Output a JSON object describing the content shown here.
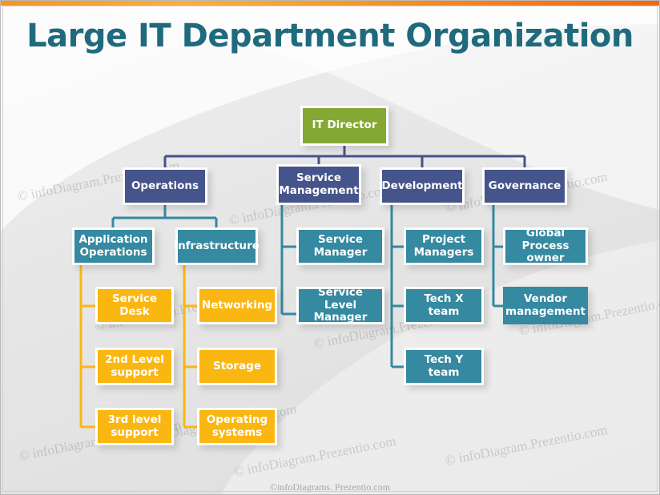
{
  "slide": {
    "title": "Large IT Department Organization",
    "title_color": "#1f6a7d",
    "background_color": "#e9e9e9",
    "accent_bar_color": "#f7941e"
  },
  "palette": {
    "green": "#85a835",
    "navy": "#45548b",
    "teal": "#3589a0",
    "orange": "#fbb711",
    "white": "#ffffff"
  },
  "watermarks": {
    "tile_text": "© infoDiagram.Prezentio.com",
    "footer_text": "©infoDiagrams. Prezentio.com"
  },
  "chart_data": {
    "type": "diagram",
    "diagram_type": "organization-chart",
    "title": "Large IT Department Organization",
    "levels": 4,
    "nodes": [
      {
        "id": "it-director",
        "label": "IT Director",
        "level": 1,
        "color": "#85a835",
        "parent": null
      },
      {
        "id": "operations",
        "label": "Operations",
        "level": 2,
        "color": "#45548b",
        "parent": "it-director"
      },
      {
        "id": "service-management",
        "label": "Service Management",
        "level": 2,
        "color": "#45548b",
        "parent": "it-director"
      },
      {
        "id": "development",
        "label": "Development",
        "level": 2,
        "color": "#45548b",
        "parent": "it-director"
      },
      {
        "id": "governance",
        "label": "Governance",
        "level": 2,
        "color": "#45548b",
        "parent": "it-director"
      },
      {
        "id": "application-operations",
        "label": "Application Operations",
        "level": 3,
        "color": "#3589a0",
        "parent": "operations"
      },
      {
        "id": "infrastructure",
        "label": "Infrastructure",
        "level": 3,
        "color": "#3589a0",
        "parent": "operations"
      },
      {
        "id": "service-manager",
        "label": "Service Manager",
        "level": 3,
        "color": "#3589a0",
        "parent": "service-management"
      },
      {
        "id": "service-level-manager",
        "label": "Service Level Manager",
        "level": 3,
        "color": "#3589a0",
        "parent": "service-management"
      },
      {
        "id": "project-managers",
        "label": "Project Managers",
        "level": 3,
        "color": "#3589a0",
        "parent": "development"
      },
      {
        "id": "tech-x-team",
        "label": "Tech X team",
        "level": 3,
        "color": "#3589a0",
        "parent": "development"
      },
      {
        "id": "tech-y-team",
        "label": "Tech Y team",
        "level": 3,
        "color": "#3589a0",
        "parent": "development"
      },
      {
        "id": "global-process-owner",
        "label": "Global Process owner",
        "level": 3,
        "color": "#3589a0",
        "parent": "governance"
      },
      {
        "id": "vendor-management",
        "label": "Vendor management",
        "level": 3,
        "color": "#3589a0",
        "parent": "governance"
      },
      {
        "id": "service-desk",
        "label": "Service Desk",
        "level": 4,
        "color": "#fbb711",
        "parent": "application-operations"
      },
      {
        "id": "second-level-support",
        "label": "2nd Level support",
        "level": 4,
        "color": "#fbb711",
        "parent": "application-operations"
      },
      {
        "id": "third-level-support",
        "label": "3rd level support",
        "level": 4,
        "color": "#fbb711",
        "parent": "application-operations"
      },
      {
        "id": "networking",
        "label": "Networking",
        "level": 4,
        "color": "#fbb711",
        "parent": "infrastructure"
      },
      {
        "id": "storage",
        "label": "Storage",
        "level": 4,
        "color": "#fbb711",
        "parent": "infrastructure"
      },
      {
        "id": "operating-systems",
        "label": "Operating systems",
        "level": 4,
        "color": "#fbb711",
        "parent": "infrastructure"
      }
    ]
  }
}
